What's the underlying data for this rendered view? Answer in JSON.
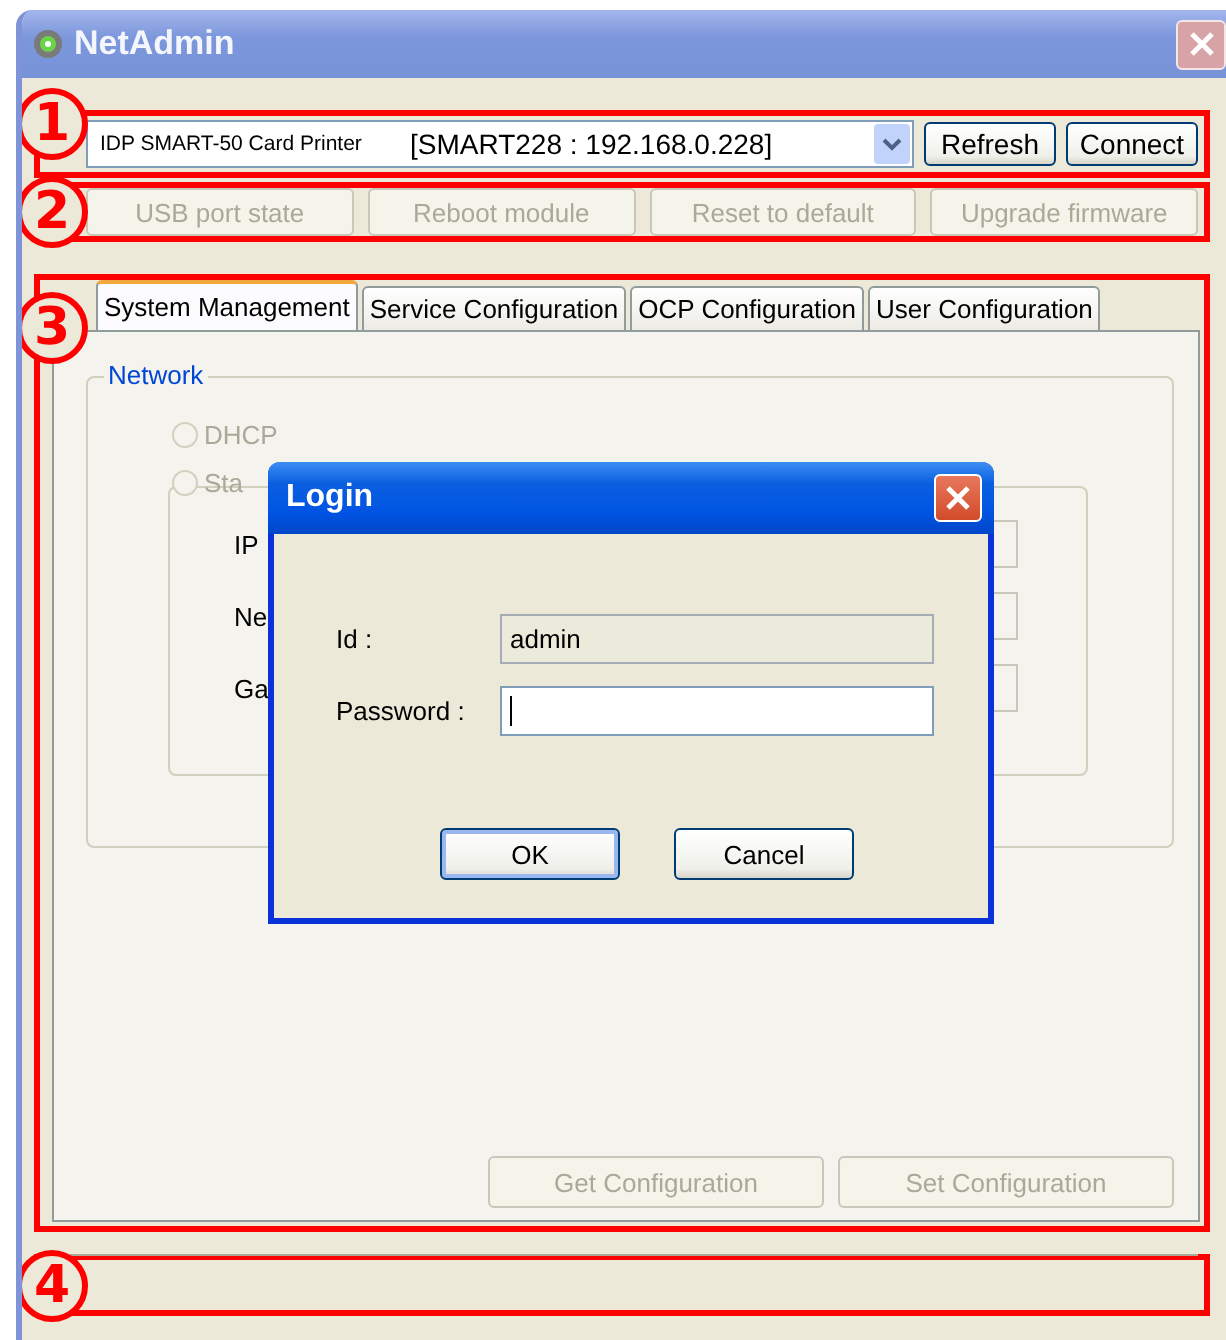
{
  "window": {
    "title": "NetAdmin"
  },
  "connection": {
    "device": "IDP SMART-50 Card Printer",
    "address": "[SMART228 : 192.168.0.228]",
    "buttons": [
      {
        "label": "Refresh"
      },
      {
        "label": "Connect"
      }
    ]
  },
  "actions": [
    {
      "label": "USB port state",
      "disabled": true
    },
    {
      "label": "Reboot module",
      "disabled": true
    },
    {
      "label": "Reset to default",
      "disabled": true
    },
    {
      "label": "Upgrade firmware",
      "disabled": true
    }
  ],
  "tabs": [
    {
      "label": "System Management",
      "selected": true
    },
    {
      "label": "Service Configuration",
      "selected": false
    },
    {
      "label": "OCP Configuration",
      "selected": false
    },
    {
      "label": "User Configuration",
      "selected": false
    }
  ],
  "network": {
    "title": "Network",
    "options": [
      {
        "label": "DHCP",
        "selected": false
      },
      {
        "label": "Sta",
        "selected": false
      }
    ],
    "fields": [
      {
        "label": "IP"
      },
      {
        "label": "Ne"
      },
      {
        "label": "Ga"
      }
    ]
  },
  "config_buttons": [
    {
      "label": "Get Configuration",
      "disabled": true
    },
    {
      "label": "Set Configuration",
      "disabled": true
    }
  ],
  "login": {
    "title": "Login",
    "fields": [
      {
        "label": "Id :",
        "value": "admin",
        "disabled": true
      },
      {
        "label": "Password :",
        "focused": true
      }
    ],
    "buttons": [
      {
        "label": "OK",
        "default": true
      },
      {
        "label": "Cancel",
        "default": false
      }
    ]
  },
  "callouts": [
    {
      "label": "1"
    },
    {
      "label": "2"
    },
    {
      "label": "3"
    },
    {
      "label": "4"
    }
  ]
}
